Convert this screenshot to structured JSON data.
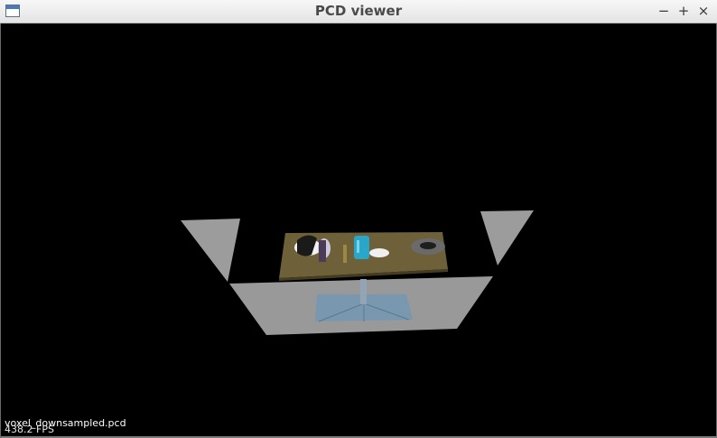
{
  "window": {
    "title": "PCD viewer",
    "controls": {
      "minimize": "−",
      "maximize": "+",
      "close": "×"
    }
  },
  "viewer": {
    "filename": "voxel_downsampled.pcd",
    "fps": "438.2 FPS",
    "background_color": "#000000",
    "scene_colors": {
      "floor": "#9a9a9a",
      "table_top": "#6e6038",
      "table_edge": "#4c4226",
      "table_base": "#7e9ab0",
      "can": "#2aa6c8"
    }
  }
}
